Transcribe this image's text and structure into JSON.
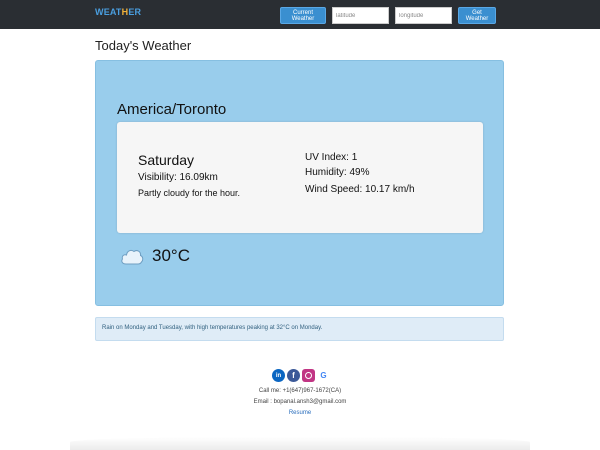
{
  "navbar": {
    "brand_part1": "WEAT",
    "brand_part2": "H",
    "brand_part3": "ER",
    "current_weather_label": "Current Weather",
    "latitude_placeholder": "latitude",
    "longitude_placeholder": "longitude",
    "get_weather_label": "Get Weather"
  },
  "page": {
    "title": "Today's Weather"
  },
  "weather": {
    "city": "America/Toronto",
    "day": "Saturday",
    "visibility": "Visibility: 16.09km",
    "summary": "Partly cloudy for the hour.",
    "uv_index": "UV Index: 1",
    "humidity": "Humidity: 49%",
    "wind_speed": "Wind Speed: 10.17 km/h",
    "temperature": "30°C",
    "icon": "cloud-icon"
  },
  "forecast": {
    "text": "Rain on Monday and Tuesday, with high temperatures peaking at 32°C on Monday."
  },
  "footer": {
    "social": {
      "linkedin": "in",
      "facebook": "f",
      "google": "G"
    },
    "call": "Call me: +1(647)967-1672(CA)",
    "email": "Email : bopanal.ansh3@gmail.com",
    "resume": "Resume"
  },
  "colors": {
    "navbar_bg": "#2a2e33",
    "button_blue": "#3a8fd0",
    "card_blue": "#99cdec",
    "forecast_bg": "#dfecf7"
  }
}
